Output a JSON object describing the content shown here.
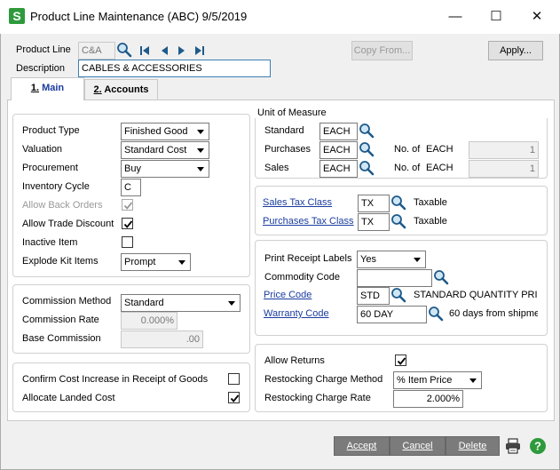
{
  "window": {
    "app_icon_letter": "S",
    "title": "Product Line Maintenance (ABC) 9/5/2019"
  },
  "header": {
    "product_line_label": "Product Line",
    "product_line_value": "C&A",
    "description_label": "Description",
    "description_value": "CABLES & ACCESSORIES",
    "copy_from_label": "Copy From...",
    "apply_label": "Apply..."
  },
  "tabs": [
    {
      "num": "1.",
      "label": "Main"
    },
    {
      "num": "2.",
      "label": "Accounts"
    }
  ],
  "main": {
    "product_type_label": "Product Type",
    "product_type_value": "Finished Good",
    "valuation_label": "Valuation",
    "valuation_value": "Standard Cost",
    "procurement_label": "Procurement",
    "procurement_value": "Buy",
    "inventory_cycle_label": "Inventory Cycle",
    "inventory_cycle_value": "C",
    "allow_back_orders_label": "Allow Back Orders",
    "allow_trade_discount_label": "Allow Trade Discount",
    "inactive_item_label": "Inactive Item",
    "explode_kit_items_label": "Explode Kit Items",
    "explode_kit_items_value": "Prompt",
    "commission_method_label": "Commission Method",
    "commission_method_value": "Standard",
    "commission_rate_label": "Commission Rate",
    "commission_rate_value": "0.000%",
    "base_commission_label": "Base Commission",
    "base_commission_value": ".00",
    "confirm_cost_label": "Confirm Cost Increase in Receipt of Goods",
    "allocate_landed_cost_label": "Allocate Landed Cost"
  },
  "uom": {
    "section_label": "Unit of Measure",
    "standard_label": "Standard",
    "standard_value": "EACH",
    "purchases_label": "Purchases",
    "purchases_value": "EACH",
    "sales_label": "Sales",
    "sales_value": "EACH",
    "no_of_label": "No. of",
    "purchases_unit": "EACH",
    "purchases_count": "1",
    "sales_unit": "EACH",
    "sales_count": "1"
  },
  "tax": {
    "sales_tax_class_label": "Sales Tax Class",
    "sales_tax_class_value": "TX",
    "sales_tax_desc": "Taxable",
    "purchases_tax_class_label": "Purchases Tax Class",
    "purchases_tax_class_value": "TX",
    "purchases_tax_desc": "Taxable"
  },
  "receipt": {
    "print_receipt_labels_label": "Print Receipt Labels",
    "print_receipt_labels_value": "Yes",
    "commodity_code_label": "Commodity Code",
    "commodity_code_value": "",
    "price_code_label": "Price Code",
    "price_code_value": "STD",
    "price_code_desc": "STANDARD QUANTITY PRICI",
    "warranty_code_label": "Warranty Code",
    "warranty_code_value": "60 DAY",
    "warranty_code_desc": "60 days from shipme"
  },
  "returns": {
    "allow_returns_label": "Allow Returns",
    "restocking_method_label": "Restocking Charge Method",
    "restocking_method_value": "% Item Price",
    "restocking_rate_label": "Restocking Charge Rate",
    "restocking_rate_value": "2.000%"
  },
  "footer": {
    "accept_label": "Accept",
    "cancel_label": "Cancel",
    "delete_label": "Delete"
  },
  "colors": {
    "link": "#1a3c9f",
    "app_icon": "#2e9a3c",
    "help_icon": "#2e9a3c"
  }
}
